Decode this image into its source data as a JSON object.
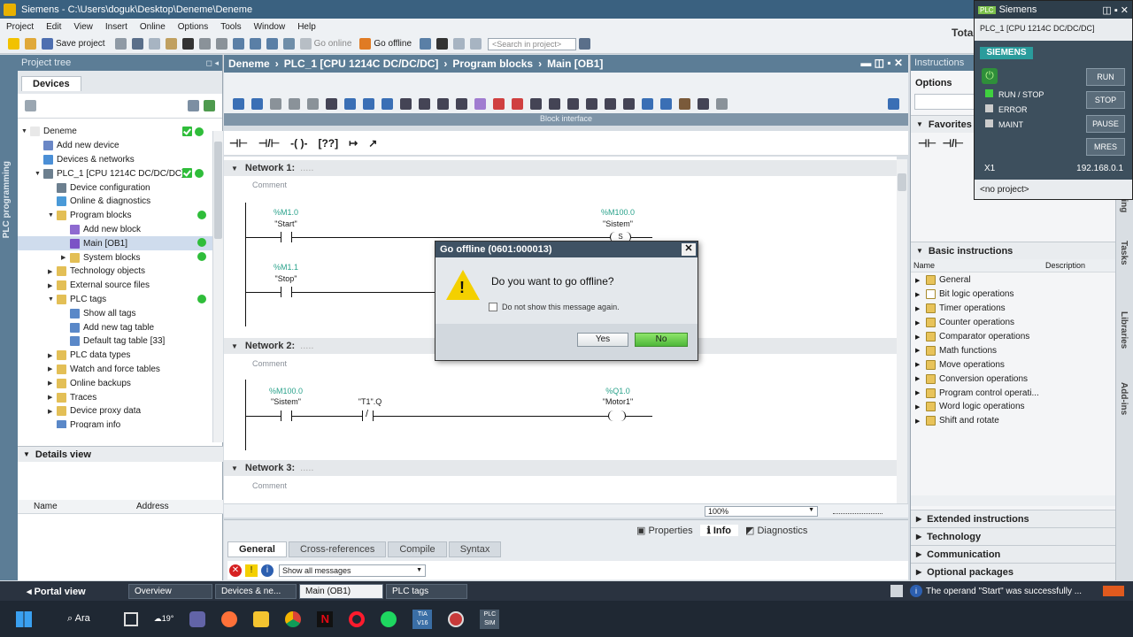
{
  "window": {
    "title": "Siemens  -  C:\\Users\\doguk\\Desktop\\Deneme\\Deneme",
    "partial_right": "Tota"
  },
  "menu": [
    "Project",
    "Edit",
    "View",
    "Insert",
    "Online",
    "Options",
    "Tools",
    "Window",
    "Help"
  ],
  "toolbar": {
    "save_label": "Save project",
    "go_online": "Go online",
    "go_offline": "Go offline",
    "search_placeholder": "<Search in project>"
  },
  "project_tree": {
    "header": "Project tree",
    "tab": "Devices",
    "items": [
      {
        "label": "Deneme",
        "indent": 0,
        "tri": "▼",
        "icon": "project-icon",
        "color": "#e8e8e8",
        "status": "both"
      },
      {
        "label": "Add new device",
        "indent": 1,
        "tri": "",
        "icon": "add-device-icon",
        "color": "#6a87c6",
        "status": ""
      },
      {
        "label": "Devices & networks",
        "indent": 1,
        "tri": "",
        "icon": "network-icon",
        "color": "#4b8fd6",
        "status": ""
      },
      {
        "label": "PLC_1 [CPU 1214C DC/DC/DC]",
        "indent": 1,
        "tri": "▼",
        "icon": "plc-icon",
        "color": "#6c7f8f",
        "status": "both"
      },
      {
        "label": "Device configuration",
        "indent": 2,
        "tri": "",
        "icon": "device-config-icon",
        "color": "#6c7f8f",
        "status": ""
      },
      {
        "label": "Online & diagnostics",
        "indent": 2,
        "tri": "",
        "icon": "diagnostics-icon",
        "color": "#4a9ad8",
        "status": ""
      },
      {
        "label": "Program blocks",
        "indent": 2,
        "tri": "▼",
        "icon": "folder-icon",
        "color": "#e3bf56",
        "status": "dot"
      },
      {
        "label": "Add new block",
        "indent": 3,
        "tri": "",
        "icon": "add-block-icon",
        "color": "#8e6ad0",
        "status": ""
      },
      {
        "label": "Main [OB1]",
        "indent": 3,
        "tri": "",
        "icon": "ob-icon",
        "color": "#7b52c6",
        "status": "dot",
        "selected": true
      },
      {
        "label": "System blocks",
        "indent": 3,
        "tri": "▶",
        "icon": "folder-icon",
        "color": "#e3bf56",
        "status": "dot"
      },
      {
        "label": "Technology objects",
        "indent": 2,
        "tri": "▶",
        "icon": "folder-icon",
        "color": "#e3bf56",
        "status": ""
      },
      {
        "label": "External source files",
        "indent": 2,
        "tri": "▶",
        "icon": "folder-icon",
        "color": "#e3bf56",
        "status": ""
      },
      {
        "label": "PLC tags",
        "indent": 2,
        "tri": "▼",
        "icon": "folder-icon",
        "color": "#e3bf56",
        "status": "dot"
      },
      {
        "label": "Show all tags",
        "indent": 3,
        "tri": "",
        "icon": "tags-icon",
        "color": "#5a88c8",
        "status": ""
      },
      {
        "label": "Add new tag table",
        "indent": 3,
        "tri": "",
        "icon": "add-tag-icon",
        "color": "#5a88c8",
        "status": ""
      },
      {
        "label": "Default tag table [33]",
        "indent": 3,
        "tri": "",
        "icon": "tag-table-icon",
        "color": "#5a88c8",
        "status": ""
      },
      {
        "label": "PLC data types",
        "indent": 2,
        "tri": "▶",
        "icon": "folder-icon",
        "color": "#e3bf56",
        "status": ""
      },
      {
        "label": "Watch and force tables",
        "indent": 2,
        "tri": "▶",
        "icon": "folder-icon",
        "color": "#e3bf56",
        "status": ""
      },
      {
        "label": "Online backups",
        "indent": 2,
        "tri": "▶",
        "icon": "folder-icon",
        "color": "#e3bf56",
        "status": ""
      },
      {
        "label": "Traces",
        "indent": 2,
        "tri": "▶",
        "icon": "folder-icon",
        "color": "#e3bf56",
        "status": ""
      },
      {
        "label": "Device proxy data",
        "indent": 2,
        "tri": "▶",
        "icon": "folder-icon",
        "color": "#e3bf56",
        "status": ""
      },
      {
        "label": "Program info",
        "indent": 2,
        "tri": "",
        "icon": "info-icon",
        "color": "#5a88c8",
        "status": ""
      },
      {
        "label": "PLC alarm text lists",
        "indent": 2,
        "tri": "",
        "icon": "alarm-icon",
        "color": "#5a88c8",
        "status": ""
      }
    ],
    "details_header": "Details view",
    "details_cols": [
      "Name",
      "Address"
    ]
  },
  "side_tab_left": "PLC programming",
  "editor": {
    "breadcrumb": [
      "Deneme",
      "PLC_1 [CPU 1214C DC/DC/DC]",
      "Program blocks",
      "Main [OB1]"
    ],
    "block_interface": "Block interface",
    "zoom": "100%",
    "networks": [
      {
        "title": "Network 1:",
        "comment": "Comment"
      },
      {
        "title": "Network 2:",
        "comment": "Comment"
      },
      {
        "title": "Network 3:",
        "comment": "Comment"
      }
    ],
    "n1": {
      "c1_addr": "%M1.0",
      "c1_name": "\"Start\"",
      "c2_addr": "%M1.1",
      "c2_name": "\"Stop\"",
      "coil_addr": "%M100.0",
      "coil_name": "\"Sistem\"",
      "coil_letter": "S"
    },
    "n2": {
      "c1_addr": "%M100.0",
      "c1_name": "\"Sistem\"",
      "c2_name": "\"T1\".Q",
      "coil_addr": "%Q1.0",
      "coil_name": "\"Motor1\""
    }
  },
  "dialog": {
    "title": "Go offline (0601:000013)",
    "message": "Do you want to go offline?",
    "checkbox": "Do not show this message again.",
    "yes": "Yes",
    "no": "No"
  },
  "bottom": {
    "props_tabs": [
      "Properties",
      "Info",
      "Diagnostics"
    ],
    "tabs": [
      "General",
      "Cross-references",
      "Compile",
      "Syntax"
    ],
    "filter": "Show all messages"
  },
  "right_panel": {
    "header": "Instructions",
    "options": "Options",
    "favorites": "Favorites",
    "basic": "Basic instructions",
    "cols": [
      "Name",
      "Description"
    ],
    "items": [
      "General",
      "Bit logic operations",
      "Timer operations",
      "Counter operations",
      "Comparator operations",
      "Math functions",
      "Move operations",
      "Conversion operations",
      "Program control operati...",
      "Word logic operations",
      "Shift and rotate"
    ],
    "sections": [
      "Extended instructions",
      "Technology",
      "Communication",
      "Optional packages"
    ],
    "side_tabs": [
      "ting",
      "Tasks",
      "Libraries",
      "Add-ins"
    ]
  },
  "plcsim": {
    "title": "Siemens",
    "device": "PLC_1 [CPU 1214C DC/DC/DC]",
    "brand": "SIEMENS",
    "leds": [
      "RUN / STOP",
      "ERROR",
      "MAINT"
    ],
    "buttons": [
      "RUN",
      "STOP",
      "PAUSE",
      "MRES"
    ],
    "port": "X1",
    "ip": "192.168.0.1",
    "project": "<no project>"
  },
  "portal_bar": {
    "portal": "Portal view",
    "items": [
      "Overview",
      "Devices & ne...",
      "Main (OB1)",
      "PLC tags"
    ],
    "message": "The operand \"Start\" was successfully ..."
  },
  "taskbar": {
    "search": "Ara",
    "weather": "19°",
    "tia_label": "TIA V16",
    "plcsim_label": "PLC SIM"
  }
}
